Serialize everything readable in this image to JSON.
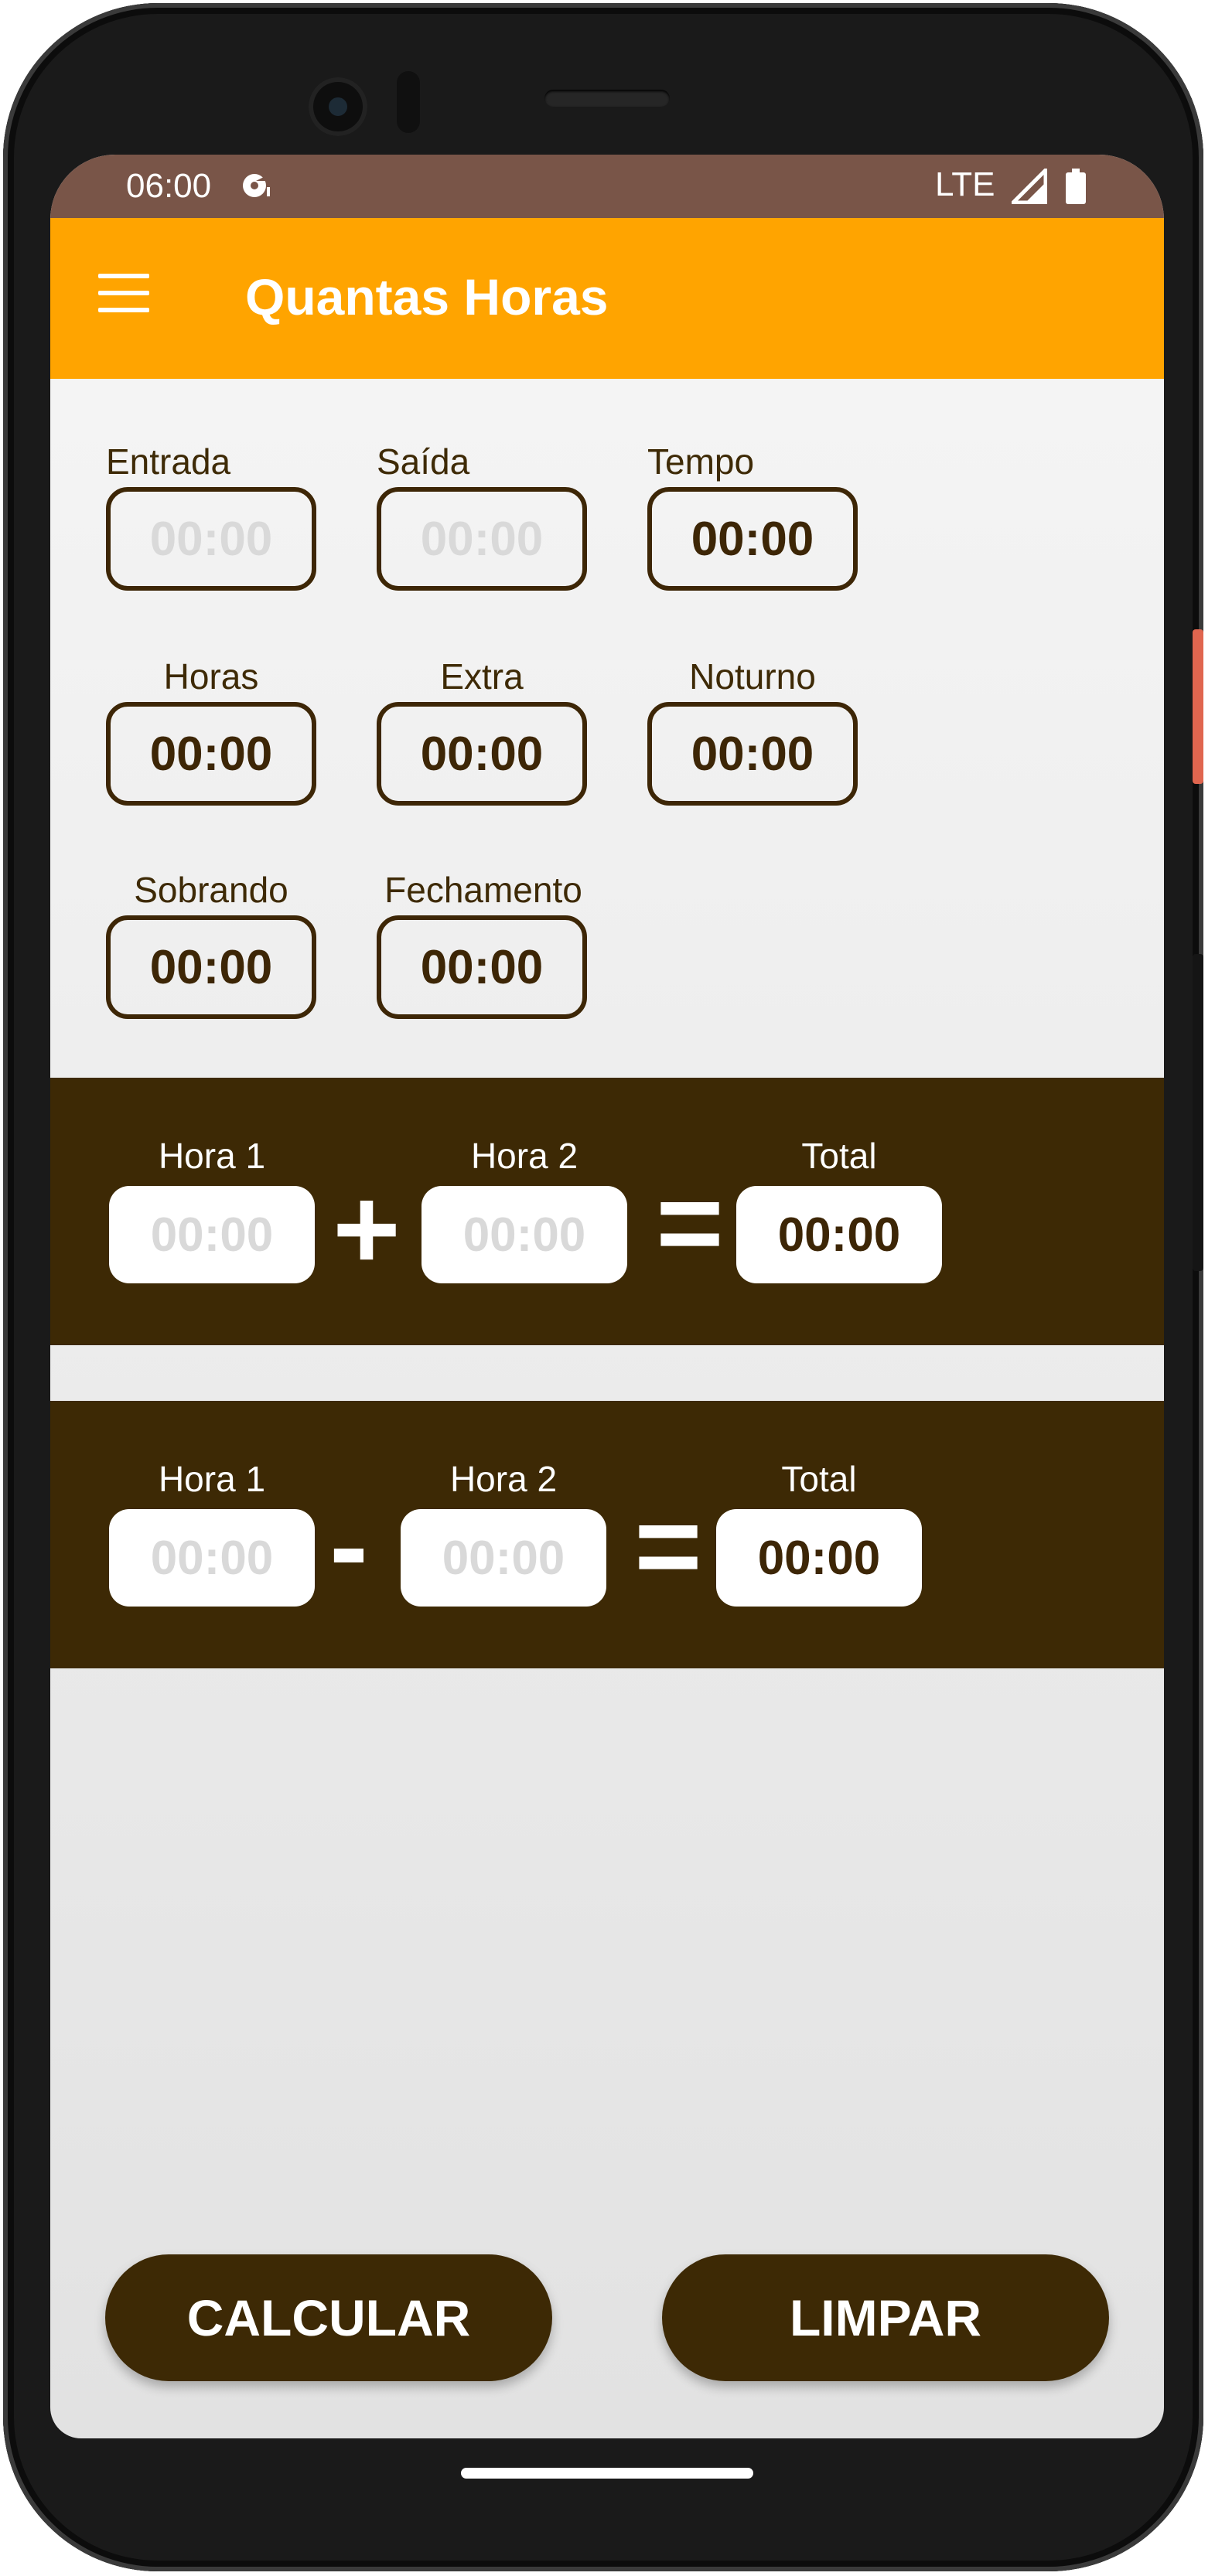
{
  "status_bar": {
    "time": "06:00",
    "network": "LTE",
    "notification_icon": "media-disc-icon",
    "signal_icon": "signal-icon",
    "battery_icon": "battery-icon",
    "color": "#795548"
  },
  "app_bar": {
    "title": "Quantas Horas",
    "menu_icon": "menu-icon",
    "color": "#ffa400"
  },
  "fields": {
    "entrada": {
      "label": "Entrada",
      "placeholder": "00:00"
    },
    "saida": {
      "label": "Saída",
      "placeholder": "00:00"
    },
    "tempo": {
      "label": "Tempo",
      "value": "00:00"
    },
    "horas": {
      "label": "Horas",
      "value": "00:00"
    },
    "extra": {
      "label": "Extra",
      "value": "00:00"
    },
    "noturno": {
      "label": "Noturno",
      "value": "00:00"
    },
    "sobrando": {
      "label": "Sobrando",
      "value": "00:00"
    },
    "fechamento": {
      "label": "Fechamento",
      "value": "00:00"
    }
  },
  "sum_panel": {
    "hora1": {
      "label": "Hora 1",
      "placeholder": "00:00"
    },
    "operator": "+",
    "hora2": {
      "label": "Hora 2",
      "placeholder": "00:00"
    },
    "equals": "=",
    "total": {
      "label": "Total",
      "value": "00:00"
    }
  },
  "diff_panel": {
    "hora1": {
      "label": "Hora 1",
      "placeholder": "00:00"
    },
    "operator": "-",
    "hora2": {
      "label": "Hora 2",
      "placeholder": "00:00"
    },
    "equals": "=",
    "total": {
      "label": "Total",
      "value": "00:00"
    }
  },
  "buttons": {
    "calcular": "CALCULAR",
    "limpar": "LIMPAR"
  },
  "colors": {
    "brown": "#3d2905",
    "amber": "#ffa400",
    "placeholder": "#d9d9d9"
  }
}
